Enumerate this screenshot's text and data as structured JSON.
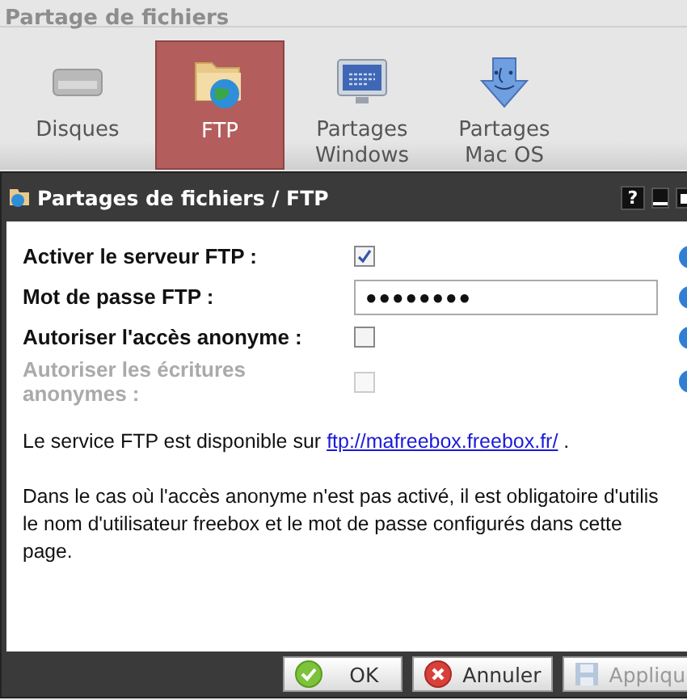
{
  "section_title": "Partage de fichiers",
  "tabs": [
    {
      "label": "Disques",
      "kind": "disk",
      "selected": false
    },
    {
      "label": "FTP",
      "kind": "ftp",
      "selected": true
    },
    {
      "label": "Partages Windows",
      "kind": "windows",
      "selected": false
    },
    {
      "label": "Partages Mac OS",
      "kind": "mac",
      "selected": false
    }
  ],
  "dialog": {
    "title": "Partages de fichiers / FTP",
    "help_button": "?",
    "fields": [
      {
        "kind": "checkbox",
        "label": "Activer le serveur FTP :",
        "checked": true,
        "disabled": false
      },
      {
        "kind": "password",
        "label": "Mot de passe FTP :",
        "value": "●●●●●●●●"
      },
      {
        "kind": "checkbox",
        "label": "Autoriser l'accès anonyme :",
        "checked": false,
        "disabled": false
      },
      {
        "kind": "checkbox",
        "label": "Autoriser les écritures anonymes :",
        "checked": false,
        "disabled": true
      }
    ],
    "info": {
      "before": "Le service FTP est disponible sur",
      "link": "ftp://mafreebox.freebox.fr/",
      "after": "."
    },
    "note_lines": [
      "Dans le cas où l'accès anonyme n'est pas activé, il est obligatoire d'utilis",
      "le nom d'utilisateur freebox et le mot de passe configurés dans cette",
      "page."
    ],
    "buttons": [
      {
        "kind": "ok",
        "label": "OK",
        "disabled": false
      },
      {
        "kind": "cancel",
        "label": "Annuler",
        "disabled": false
      },
      {
        "kind": "apply",
        "label": "Appliqu",
        "disabled": true
      }
    ]
  }
}
